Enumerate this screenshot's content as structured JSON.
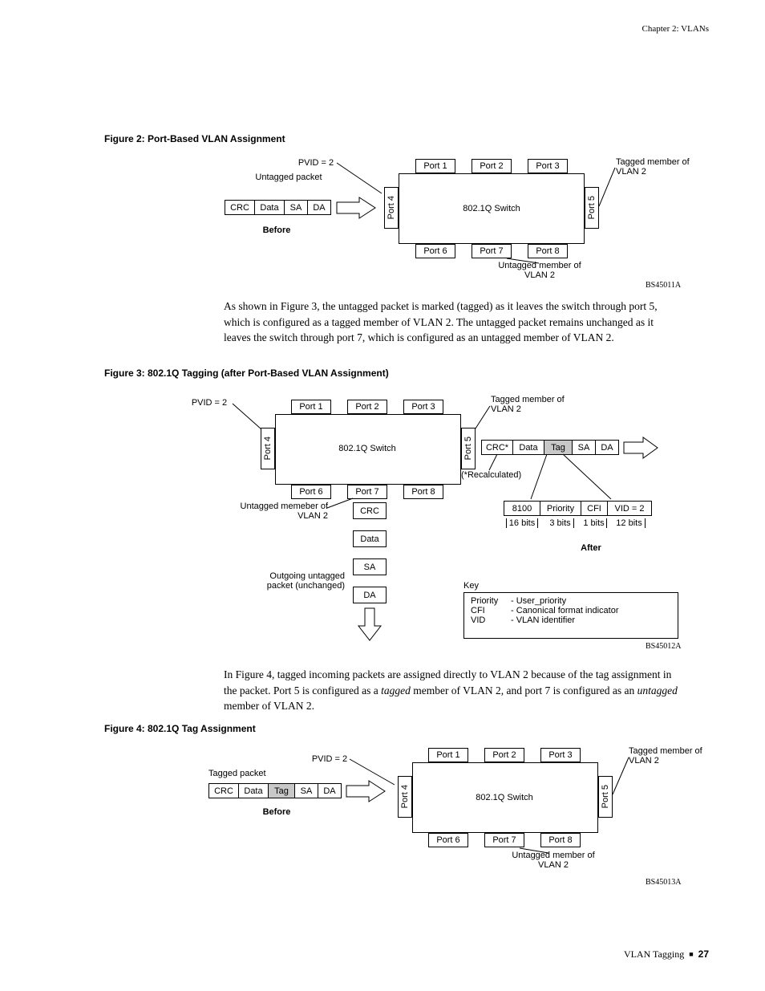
{
  "header": {
    "chapter": "Chapter 2: VLANs"
  },
  "footer": {
    "section": "VLAN Tagging",
    "page": "27"
  },
  "fig2": {
    "caption": "Figure 2:  Port-Based VLAN Assignment",
    "pvid": "PVID = 2",
    "untagged_packet": "Untagged packet",
    "pkt": {
      "crc": "CRC",
      "data": "Data",
      "sa": "SA",
      "da": "DA"
    },
    "before": "Before",
    "ports": {
      "p1": "Port 1",
      "p2": "Port 2",
      "p3": "Port 3",
      "p4": "Port 4",
      "p5": "Port 5",
      "p6": "Port 6",
      "p7": "Port 7",
      "p8": "Port 8"
    },
    "switch": "802.1Q Switch",
    "tagged_member": "Tagged member of VLAN 2",
    "untagged_member": "Untagged member of VLAN 2",
    "fignum": "BS45011A"
  },
  "para1": "As shown in Figure 3, the untagged packet is marked (tagged) as it leaves the switch through port 5, which is configured as a tagged member of VLAN 2. The untagged packet remains unchanged as it leaves the switch through port 7, which is configured as an untagged member of VLAN 2.",
  "fig3": {
    "caption": "Figure 3:  802.1Q Tagging (after Port-Based VLAN Assignment)",
    "pvid": "PVID = 2",
    "ports": {
      "p1": "Port 1",
      "p2": "Port 2",
      "p3": "Port 3",
      "p4": "Port 4",
      "p5": "Port 5",
      "p6": "Port 6",
      "p7": "Port 7",
      "p8": "Port 8"
    },
    "switch": "802.1Q Switch",
    "tagged_member": "Tagged member of VLAN 2",
    "recalc": "(*Recalculated)",
    "pkt_out": {
      "crc": "CRC*",
      "data": "Data",
      "tag": "Tag",
      "sa": "SA",
      "da": "DA"
    },
    "tag_fields": {
      "f1": "8100",
      "f2": "Priority",
      "f3": "CFI",
      "f4": "VID = 2"
    },
    "bits": {
      "b1": "16 bits",
      "b2": "3 bits",
      "b3": "1 bits",
      "b4": "12 bits"
    },
    "after": "After",
    "untagged_member": "Untagged memeber of VLAN 2",
    "outgoing": "Outgoing untagged packet (unchanged)",
    "vpkt": {
      "crc": "CRC",
      "data": "Data",
      "sa": "SA",
      "da": "DA"
    },
    "key_title": "Key",
    "key": {
      "l1a": "Priority",
      "l1b": "- User_priority",
      "l2a": "CFI",
      "l2b": "- Canonical format indicator",
      "l3a": "VID",
      "l3b": "- VLAN identifier"
    },
    "fignum": "BS45012A"
  },
  "para2_a": "In Figure 4, tagged incoming packets are assigned directly to VLAN 2 because of the tag assignment in the packet. Port 5 is configured as a ",
  "para2_b": "tagged",
  "para2_c": " member of VLAN 2, and port 7 is configured as an ",
  "para2_d": "untagged",
  "para2_e": " member of VLAN 2.",
  "fig4": {
    "caption": "Figure 4:  802.1Q Tag Assignment",
    "pvid": "PVID = 2",
    "tagged_packet": "Tagged packet",
    "pkt": {
      "crc": "CRC",
      "data": "Data",
      "tag": "Tag",
      "sa": "SA",
      "da": "DA"
    },
    "before": "Before",
    "ports": {
      "p1": "Port 1",
      "p2": "Port 2",
      "p3": "Port 3",
      "p4": "Port 4",
      "p5": "Port 5",
      "p6": "Port 6",
      "p7": "Port 7",
      "p8": "Port 8"
    },
    "switch": "802.1Q Switch",
    "tagged_member": "Tagged member of VLAN 2",
    "untagged_member": "Untagged member of VLAN 2",
    "fignum": "BS45013A"
  }
}
